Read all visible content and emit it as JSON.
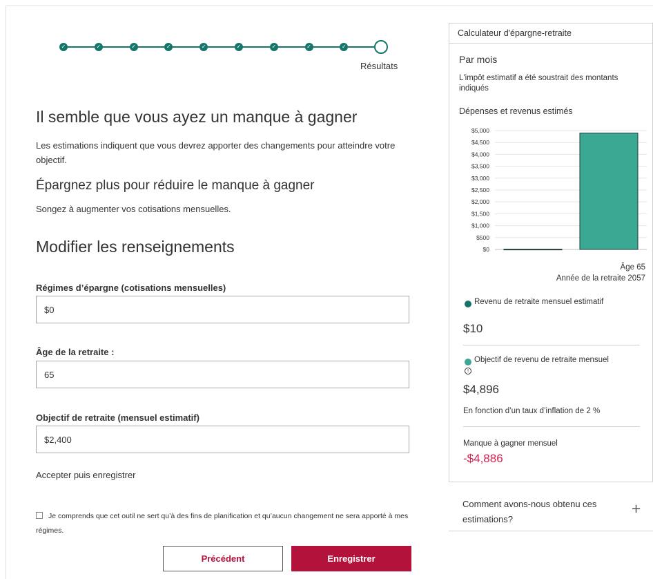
{
  "progress": {
    "step_label": "Résultats",
    "completed_steps": 9,
    "total_steps": 10,
    "check_glyph": "✓"
  },
  "main": {
    "heading": "Il semble que vous ayez un manque à gagner",
    "intro": "Les estimations indiquent que vous devrez apporter des changements pour atteindre votre objectif.",
    "save_heading": "Épargnez plus pour réduire le manque à gagner",
    "save_text": "Songez à augmenter vos cotisations mensuelles.",
    "modify_heading": "Modifier les renseignements"
  },
  "form": {
    "savings": {
      "label": "Régimes d’épargne (cotisations mensuelles)",
      "value": "$0"
    },
    "retirement_age": {
      "label": "Âge de la retraite :",
      "value": "65"
    },
    "goal": {
      "label": "Objectif de retraite (mensuel estimatif)",
      "value": "$2,400"
    },
    "accept_link": "Accepter puis enregistrer",
    "consent_text": "Je comprends que cet outil ne sert qu’à des fins de planification et qu’aucun changement ne sera apporté à mes régimes.",
    "consent_checked": false,
    "prev_button": "Précédent",
    "save_button": "Enregistrer"
  },
  "sidebar": {
    "title": "Calculateur d'épargne-retraite",
    "period": "Par mois",
    "tax_note": "L'impôt estimatif a été soustrait des montants indiqués",
    "chart_title": "Dépenses et revenus estimés",
    "age_label": "Âge 65",
    "year_label": "Année de la retraite 2057",
    "income_label": "Revenu de retraite mensuel estimatif",
    "income_value": "$10",
    "goal_label": "Objectif de revenu de retraite mensuel",
    "info_glyph": "!",
    "goal_value": "$4,896",
    "inflation_note": "En fonction d’un taux d’inflation de 2 %",
    "shortfall_label": "Manque à gagner mensuel",
    "shortfall_value": "-$4,886",
    "faq_label": "Comment avons-nous obtenu ces estimations?",
    "faq_icon": "+"
  },
  "colors": {
    "teal_dark": "#16756a",
    "teal_light": "#3aa893",
    "brand_red": "#b3123b",
    "shortfall_red": "#d6204e"
  },
  "chart_data": {
    "type": "bar",
    "title": "Dépenses et revenus estimés",
    "categories": [
      "Revenu de retraite mensuel estimatif",
      "Objectif de revenu de retraite mensuel"
    ],
    "values": [
      10,
      4896
    ],
    "colors": [
      "#16756a",
      "#3aa893"
    ],
    "ylim": [
      0,
      5000
    ],
    "y_ticks": [
      "$0",
      "$500",
      "$1,000",
      "$1,500",
      "$2,000",
      "$2,500",
      "$3,000",
      "$3,500",
      "$4,000",
      "$4,500",
      "$5,000"
    ],
    "y_tick_values": [
      0,
      500,
      1000,
      1500,
      2000,
      2500,
      3000,
      3500,
      4000,
      4500,
      5000
    ],
    "grid": true
  }
}
